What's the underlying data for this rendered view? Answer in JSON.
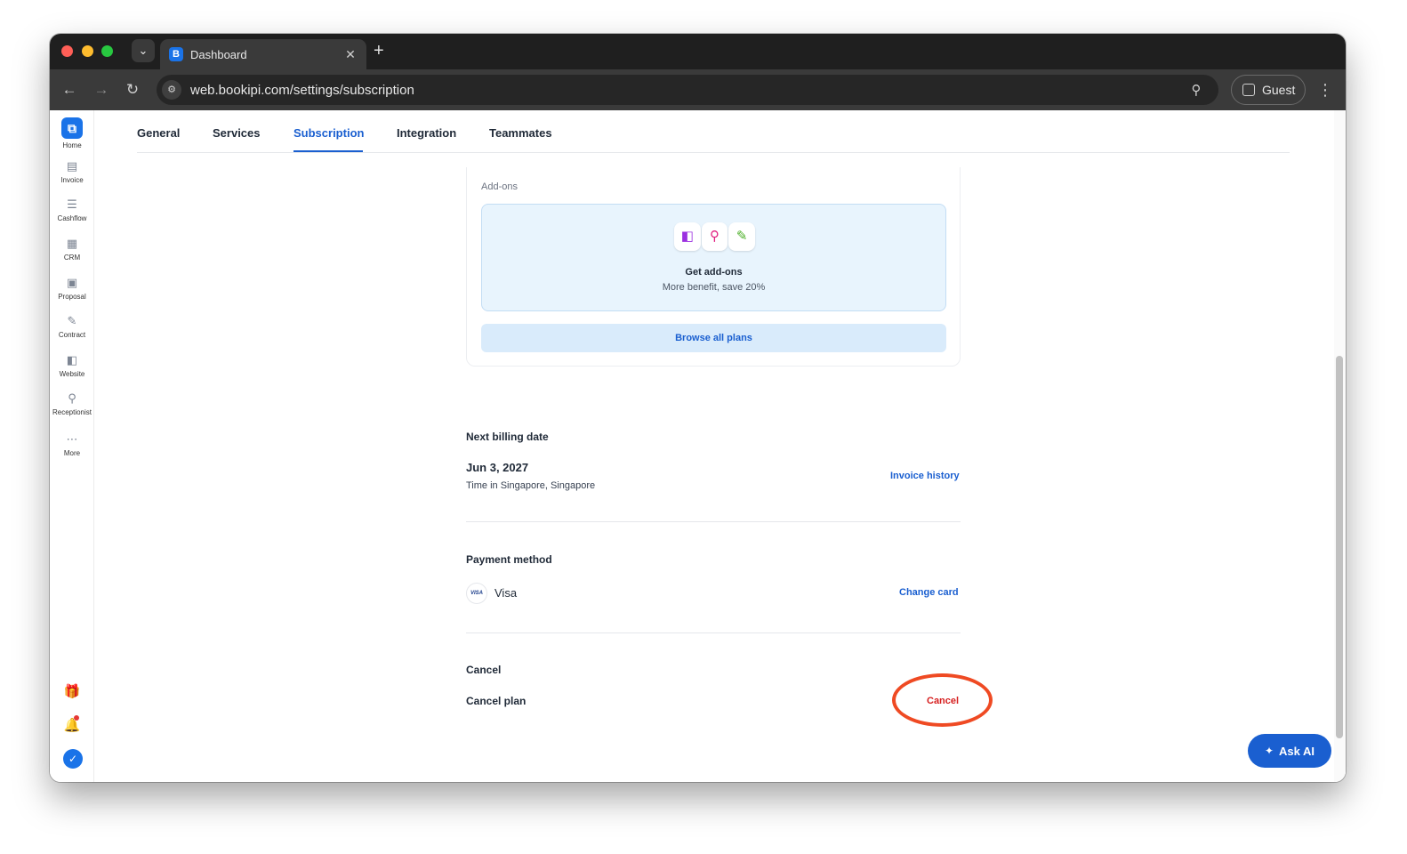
{
  "browser": {
    "tab_title": "Dashboard",
    "tab_favicon_letter": "B",
    "url": "web.bookipi.com/settings/subscription",
    "profile_label": "Guest"
  },
  "sidebar": {
    "items": [
      {
        "label": "Home",
        "icon": "home-logo-icon"
      },
      {
        "label": "Invoice",
        "icon": "invoice-icon"
      },
      {
        "label": "Cashflow",
        "icon": "cashflow-icon"
      },
      {
        "label": "CRM",
        "icon": "crm-icon"
      },
      {
        "label": "Proposal",
        "icon": "proposal-icon"
      },
      {
        "label": "Contract",
        "icon": "contract-icon"
      },
      {
        "label": "Website",
        "icon": "website-icon"
      },
      {
        "label": "Receptionist",
        "icon": "receptionist-icon"
      },
      {
        "label": "More",
        "icon": "more-icon"
      }
    ]
  },
  "settings_tabs": [
    "General",
    "Services",
    "Subscription",
    "Integration",
    "Teammates"
  ],
  "addons": {
    "title": "Add-ons",
    "heading": "Get add-ons",
    "subtitle": "More benefit, save 20%",
    "browse_label": "Browse all plans"
  },
  "billing": {
    "heading": "Next billing date",
    "date": "Jun 3, 2027",
    "timezone": "Time in Singapore, Singapore",
    "invoice_history_label": "Invoice history"
  },
  "payment": {
    "heading": "Payment method",
    "card_brand_badge": "VISA",
    "card_label": "Visa",
    "change_label": "Change card"
  },
  "cancel": {
    "heading": "Cancel",
    "plan_label": "Cancel plan",
    "button_label": "Cancel"
  },
  "ask_ai_label": "Ask AI",
  "colors": {
    "accent": "#1a5fd0",
    "danger": "#d61f1f",
    "annotation": "#ef4a23"
  }
}
